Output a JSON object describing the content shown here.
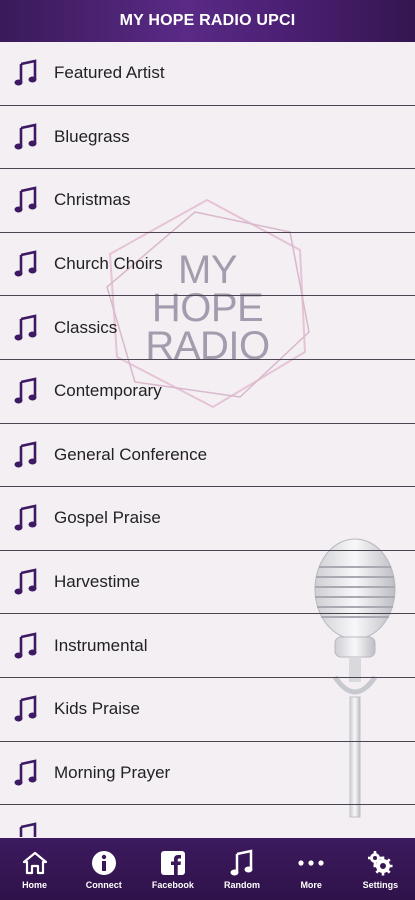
{
  "header": {
    "title": "MY HOPE RADIO UPCI"
  },
  "watermark": {
    "line1": "MY",
    "line2": "HOPE",
    "line3": "RADIO"
  },
  "genres": [
    "Featured Artist",
    "Bluegrass",
    "Christmas",
    "Church Choirs",
    "Classics",
    "Contemporary",
    "General Conference",
    "Gospel Praise",
    "Harvestime",
    "Instrumental",
    "Kids Praise",
    "Morning Prayer"
  ],
  "tabs": [
    {
      "label": "Home",
      "icon": "home-icon"
    },
    {
      "label": "Connect",
      "icon": "info-icon"
    },
    {
      "label": "Facebook",
      "icon": "facebook-icon"
    },
    {
      "label": "Random",
      "icon": "music-note-icon"
    },
    {
      "label": "More",
      "icon": "more-icon"
    },
    {
      "label": "Settings",
      "icon": "settings-icon"
    }
  ],
  "colors": {
    "accent": "#4a1f72",
    "icon": "#3d1a63"
  }
}
